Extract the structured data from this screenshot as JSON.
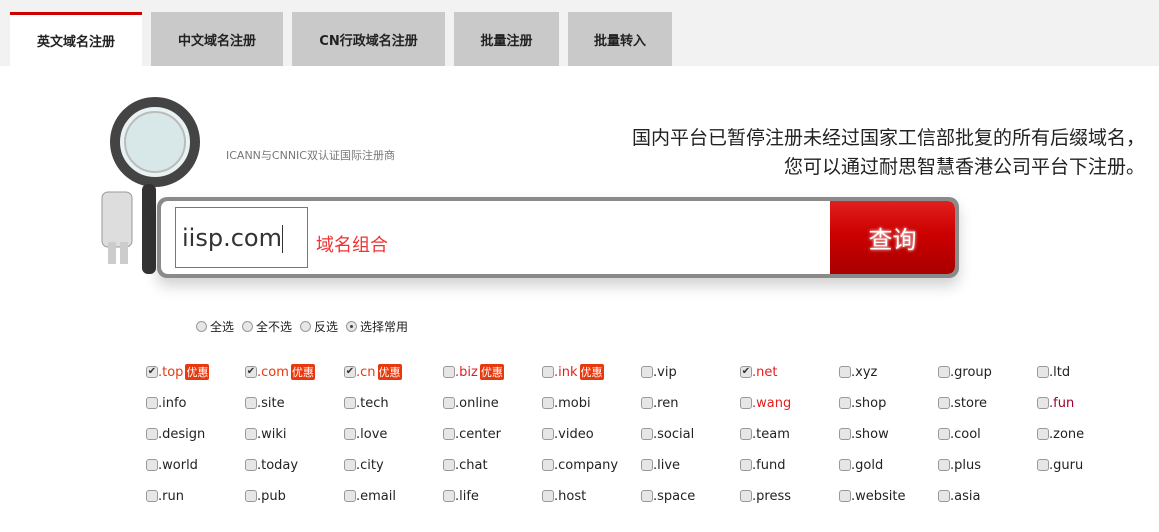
{
  "tabs": [
    {
      "label": "英文域名注册",
      "active": true
    },
    {
      "label": "中文域名注册"
    },
    {
      "label": "CN行政域名注册"
    },
    {
      "label": "批量注册"
    },
    {
      "label": "批量转入"
    }
  ],
  "tagline": "ICANN与CNNIC双认证国际注册商",
  "notice": {
    "line1": "国内平台已暂停注册未经过国家工信部批复的所有后缀域名，",
    "line2": "您可以通过耐思智慧香港公司平台下注册。"
  },
  "search": {
    "value": "iisp.com",
    "combo_label": "域名组合",
    "button": "查询"
  },
  "radios": [
    {
      "label": "全选"
    },
    {
      "label": "全不选"
    },
    {
      "label": "反选"
    },
    {
      "label": "选择常用",
      "selected": true
    }
  ],
  "badge_text": "优惠",
  "colors": {
    "accent": "#cc0000",
    "badge": "#e8380d",
    "highlight": "#e0201f",
    "dark_red": "#a0002a"
  },
  "domains": [
    {
      "name": ".top",
      "checked": true,
      "badge": true,
      "color": "#e8380d"
    },
    {
      "name": ".com",
      "checked": true,
      "badge": true,
      "color": "#e8380d"
    },
    {
      "name": ".cn",
      "checked": true,
      "badge": true,
      "color": "#e8380d"
    },
    {
      "name": ".biz",
      "badge": true,
      "color": "#e0201f"
    },
    {
      "name": ".ink",
      "badge": true,
      "color": "#e0201f"
    },
    {
      "name": ".vip"
    },
    {
      "name": ".net",
      "checked": true,
      "color": "#e0201f"
    },
    {
      "name": ".xyz"
    },
    {
      "name": ".group"
    },
    {
      "name": ".ltd"
    },
    {
      "name": ".info"
    },
    {
      "name": ".site"
    },
    {
      "name": ".tech"
    },
    {
      "name": ".online"
    },
    {
      "name": ".mobi"
    },
    {
      "name": ".ren"
    },
    {
      "name": ".wang",
      "color": "#e0201f"
    },
    {
      "name": ".shop"
    },
    {
      "name": ".store"
    },
    {
      "name": ".fun",
      "color": "#a0002a"
    },
    {
      "name": ".design"
    },
    {
      "name": ".wiki"
    },
    {
      "name": ".love"
    },
    {
      "name": ".center"
    },
    {
      "name": ".video"
    },
    {
      "name": ".social"
    },
    {
      "name": ".team"
    },
    {
      "name": ".show"
    },
    {
      "name": ".cool"
    },
    {
      "name": ".zone"
    },
    {
      "name": ".world"
    },
    {
      "name": ".today"
    },
    {
      "name": ".city"
    },
    {
      "name": ".chat"
    },
    {
      "name": ".company"
    },
    {
      "name": ".live"
    },
    {
      "name": ".fund"
    },
    {
      "name": ".gold"
    },
    {
      "name": ".plus"
    },
    {
      "name": ".guru"
    },
    {
      "name": ".run"
    },
    {
      "name": ".pub"
    },
    {
      "name": ".email"
    },
    {
      "name": ".life"
    },
    {
      "name": ".host"
    },
    {
      "name": ".space"
    },
    {
      "name": ".press"
    },
    {
      "name": ".website"
    },
    {
      "name": ".asia"
    }
  ]
}
